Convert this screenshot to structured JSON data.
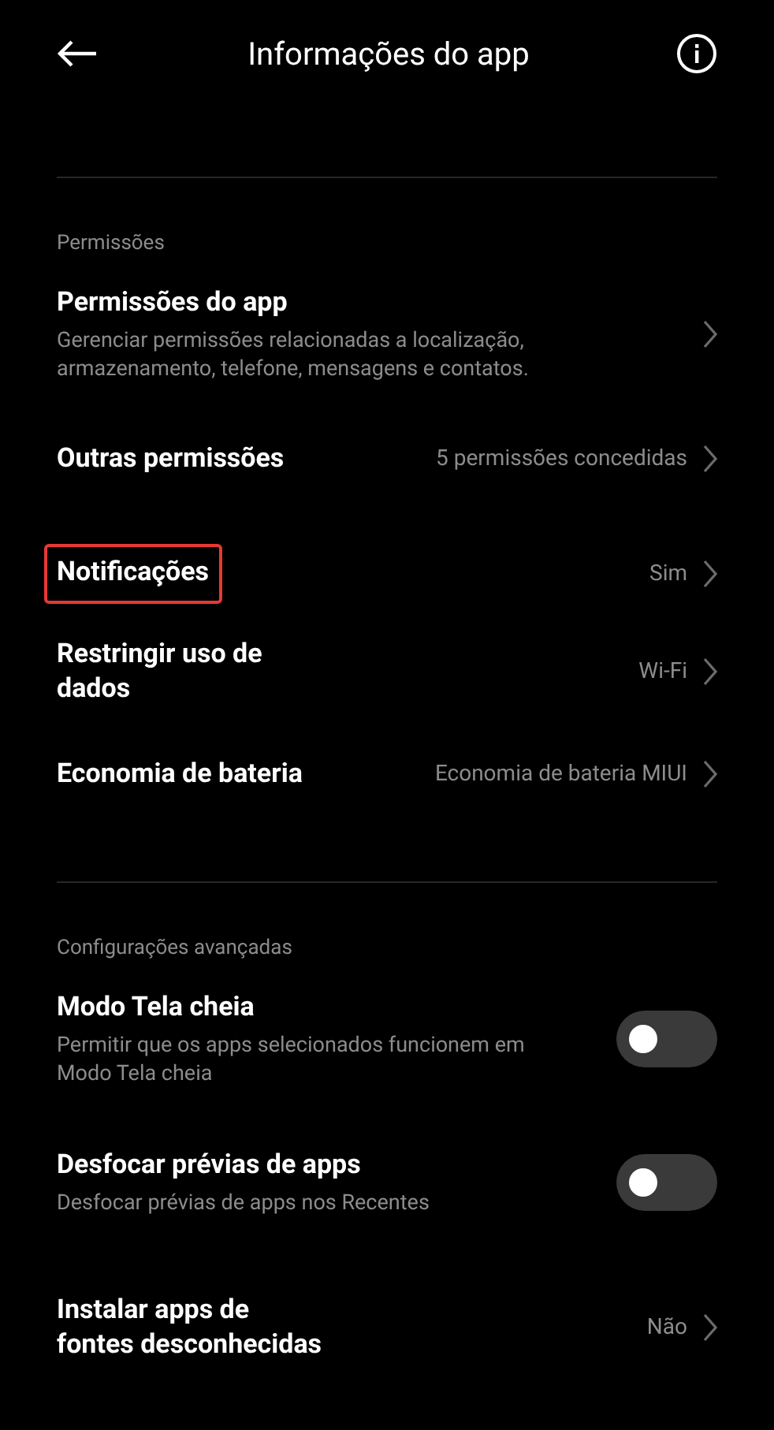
{
  "header": {
    "title": "Informações do app"
  },
  "sections": [
    {
      "label": "Permissões",
      "items": [
        {
          "kind": "link",
          "title": "Permissões do app",
          "subtitle": "Gerenciar permissões relacionadas a localização, armazenamento, telefone, mensagens e contatos.",
          "highlighted": false
        },
        {
          "kind": "link",
          "title": "Outras permissões",
          "value": "5 permissões concedidas",
          "highlighted": false
        },
        {
          "kind": "link",
          "title": "Notificações",
          "value": "Sim",
          "highlighted": true
        },
        {
          "kind": "link",
          "title": "Restringir uso de dados",
          "value": "Wi-Fi",
          "highlighted": false
        },
        {
          "kind": "link",
          "title": "Economia de bateria",
          "value": "Economia de bateria MIUI",
          "highlighted": false
        }
      ]
    },
    {
      "label": "Configurações avançadas",
      "items": [
        {
          "kind": "toggle",
          "title": "Modo Tela cheia",
          "subtitle": "Permitir que os apps selecionados funcionem em Modo Tela cheia",
          "on": false
        },
        {
          "kind": "toggle",
          "title": "Desfocar prévias de apps",
          "subtitle": "Desfocar prévias de apps nos Recentes",
          "on": false
        },
        {
          "kind": "link",
          "title": "Instalar apps de fontes desconhecidas",
          "value": "Não",
          "highlighted": false
        }
      ]
    }
  ]
}
